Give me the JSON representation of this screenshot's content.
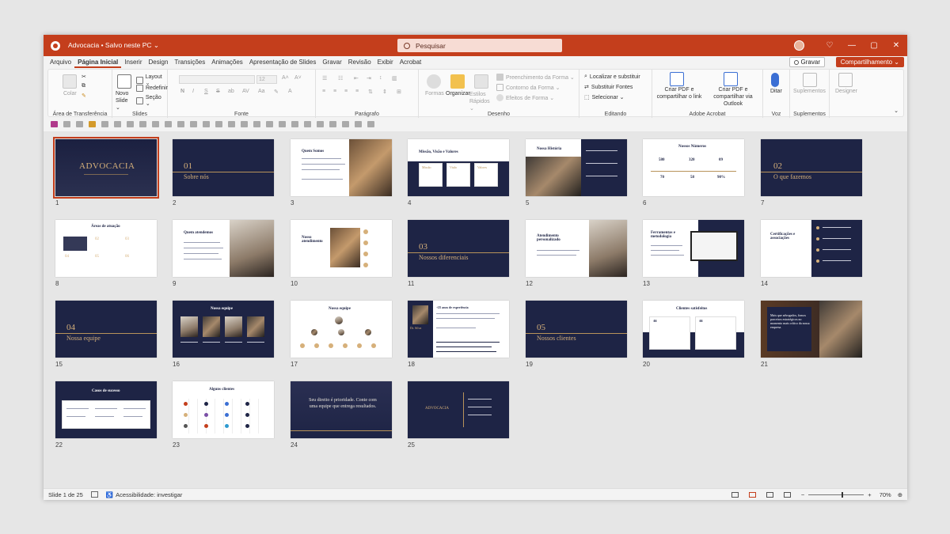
{
  "window": {
    "doc_title": "Advocacia • Salvo neste PC ⌄",
    "search_placeholder": "Pesquisar"
  },
  "menu": {
    "tabs": [
      "Arquivo",
      "Página Inicial",
      "Inserir",
      "Design",
      "Transições",
      "Animações",
      "Apresentação de Slides",
      "Gravar",
      "Revisão",
      "Exibir",
      "Acrobat"
    ],
    "active_tab": "Página Inicial",
    "record_label": "Gravar",
    "share_label": "Compartilhamento ⌄"
  },
  "ribbon": {
    "groups": {
      "clipboard": "Área de Transferência",
      "slides": "Slides",
      "font": "Fonte",
      "paragraph": "Parágrafo",
      "drawing": "Desenho",
      "editing": "Editando",
      "acrobat": "Adobe Acrobat",
      "voice": "Voz",
      "addins": "Suplementos"
    },
    "paste": "Colar",
    "new_slide": "Novo Slide ⌄",
    "layout": "Layout ⌄",
    "reset": "Redefinir",
    "section": "Seção ⌄",
    "font_size": "12",
    "bold": "N",
    "italic": "I",
    "underline": "S",
    "strike": "S",
    "shapes": "Formas",
    "arrange": "Organizar",
    "quick_styles": "Estilos Rápidos ⌄",
    "shape_fill": "Preenchimento da Forma ⌄",
    "shape_outline": "Contorno da Forma ⌄",
    "shape_effects": "Efeitos de Forma ⌄",
    "find": "Localizar e substituir",
    "replace_fonts": "Substituir Fontes",
    "select": "Selecionar ⌄",
    "create_pdf": "Criar PDF e compartilhar o link",
    "create_pdf_outlook": "Criar PDF e compartilhar via Outlook",
    "dictate": "Ditar",
    "addins": "Suplementos",
    "designer": "Designer"
  },
  "slides": [
    {
      "n": "1",
      "title": "ADVOCACIA"
    },
    {
      "n": "2",
      "title": "01",
      "sub": "Sobre nós"
    },
    {
      "n": "3",
      "title": "Quem Somos"
    },
    {
      "n": "4",
      "title": "Missão, Visão e Valores",
      "cols": [
        "Missão",
        "Visão",
        "Valores"
      ]
    },
    {
      "n": "5",
      "title": "Nossa História"
    },
    {
      "n": "6",
      "title": "Nossos Números",
      "stats": [
        "580",
        "320",
        "09",
        "70",
        "58",
        "90%"
      ]
    },
    {
      "n": "7",
      "title": "02",
      "sub": "O que fazemos"
    },
    {
      "n": "8",
      "title": "Áreas de atuação",
      "items": [
        "01",
        "02",
        "03",
        "04",
        "05",
        "06"
      ]
    },
    {
      "n": "9",
      "title": "Quem atendemos"
    },
    {
      "n": "10",
      "title": "Nosso atendimento"
    },
    {
      "n": "11",
      "title": "03",
      "sub": "Nossos diferenciais"
    },
    {
      "n": "12",
      "title": "Atendimento personalizado"
    },
    {
      "n": "13",
      "title": "Ferramentas e metodologia"
    },
    {
      "n": "14",
      "title": "Certificações e associações"
    },
    {
      "n": "15",
      "title": "04",
      "sub": "Nossa equipe"
    },
    {
      "n": "16",
      "title": "Nossa equipe"
    },
    {
      "n": "17",
      "title": "Nossa equipe"
    },
    {
      "n": "18",
      "title": "Dr. Silva",
      "sub": "+25 anos de experiência"
    },
    {
      "n": "19",
      "title": "05",
      "sub": "Nossos clientes"
    },
    {
      "n": "20",
      "title": "Clientes satisfeitos"
    },
    {
      "n": "21",
      "title": "Mais que advogados, fomos parceiros estratégicos no momento mais crítico da nossa empresa."
    },
    {
      "n": "22",
      "title": "Casos de sucesso"
    },
    {
      "n": "23",
      "title": "Alguns clientes"
    },
    {
      "n": "24",
      "title": "Seu direito é prioridade. Conte com uma equipe que entrega resultados."
    },
    {
      "n": "25",
      "title": "ADVOCACIA"
    }
  ],
  "status": {
    "slide_count": "Slide 1 de 25",
    "accessibility": "Acessibilidade: investigar",
    "zoom": "70%"
  },
  "colors": {
    "accent": "#c43e1c",
    "navy": "#1e2445",
    "gold": "#d6b07a"
  }
}
